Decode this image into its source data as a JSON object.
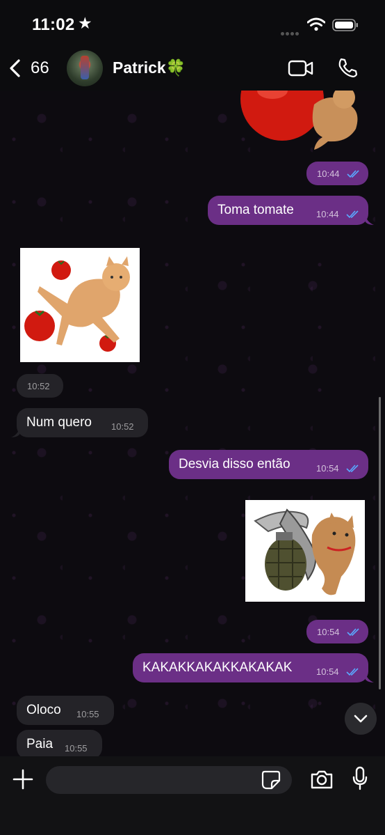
{
  "status_bar": {
    "time": "11:02",
    "star": "★"
  },
  "header": {
    "back_count": "66",
    "contact_name": "Patrick🍀"
  },
  "messages": [
    {
      "dir": "out",
      "kind": "sticker-time",
      "time": "10:44"
    },
    {
      "dir": "out",
      "kind": "text",
      "text": "Toma tomate",
      "time": "10:44"
    },
    {
      "dir": "in",
      "kind": "sticker",
      "time": "10:52"
    },
    {
      "dir": "in",
      "kind": "text",
      "text": "Num quero",
      "time": "10:52"
    },
    {
      "dir": "out",
      "kind": "text",
      "text": "Desvia disso então",
      "time": "10:54"
    },
    {
      "dir": "out",
      "kind": "sticker",
      "time": "10:54"
    },
    {
      "dir": "out",
      "kind": "text",
      "text": "KAKAKKAKAKKAKAKAK",
      "time": "10:54"
    },
    {
      "dir": "in",
      "kind": "text",
      "text": "Oloco",
      "time": "10:55"
    },
    {
      "dir": "in",
      "kind": "text",
      "text": "Paia",
      "time": "10:55"
    }
  ],
  "composer": {
    "placeholder": ""
  },
  "colors": {
    "outgoing_bubble": "#6b2f86",
    "incoming_bubble": "#242328",
    "read_ticks": "#5aa9ff"
  }
}
